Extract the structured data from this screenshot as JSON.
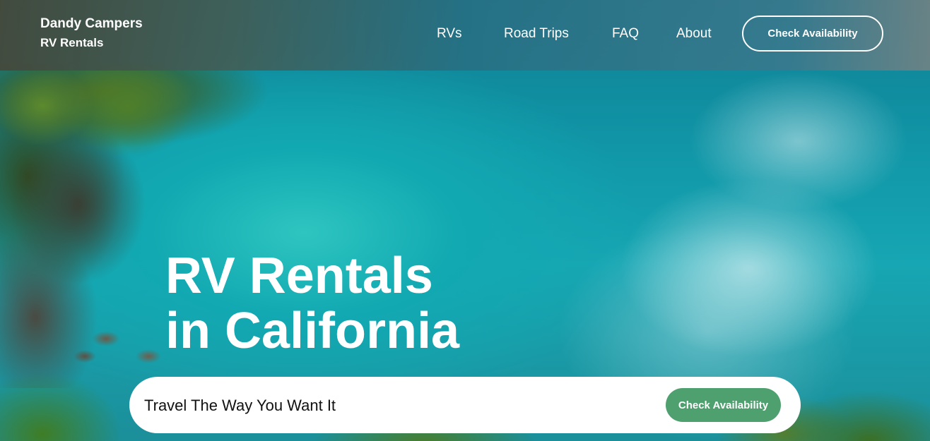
{
  "brand": {
    "name": "Dandy Campers",
    "subtitle": "RV Rentals"
  },
  "nav": {
    "items": [
      {
        "label": "RVs"
      },
      {
        "label": "Road Trips"
      },
      {
        "label": "FAQ"
      },
      {
        "label": "About"
      }
    ],
    "cta_label": "Check Availability"
  },
  "hero": {
    "headline_line1": "RV Rentals",
    "headline_line2": "in California",
    "tagline": "Travel The Way You Want It",
    "cta_label": "Check Availability"
  },
  "colors": {
    "accent_green": "#4ea06e",
    "text_light": "#ffffff"
  }
}
